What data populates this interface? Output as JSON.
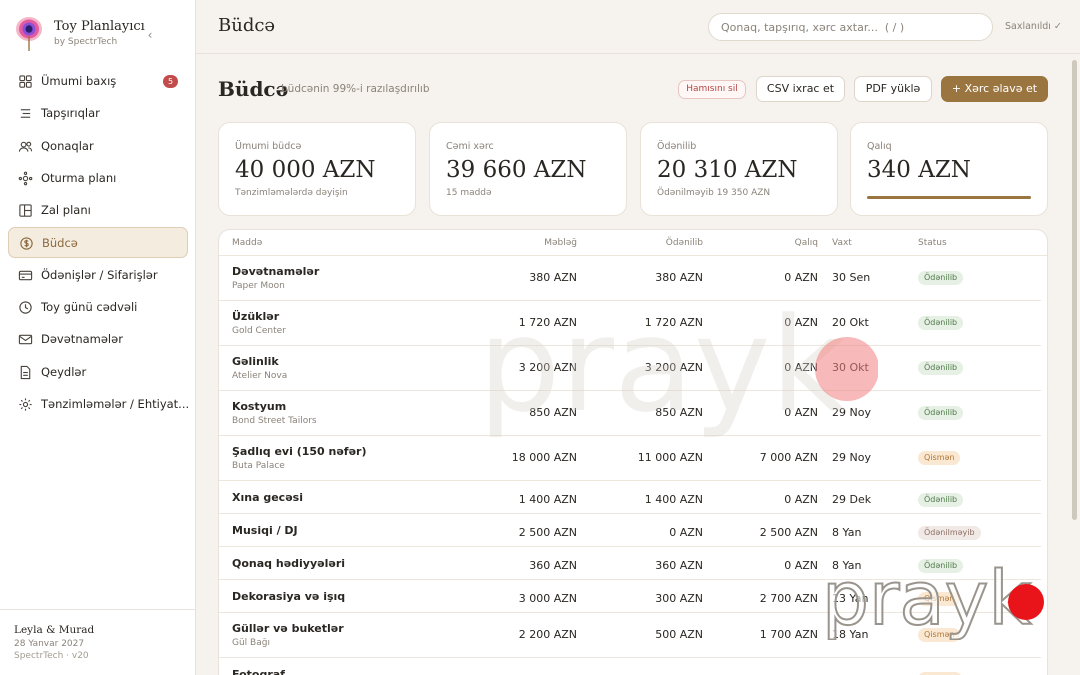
{
  "app": {
    "title": "Toy Planlayıcı",
    "subtitle": "by SpectrTech"
  },
  "sidebar": {
    "items": [
      {
        "label": "Ümumi baxış",
        "icon": "grid-icon",
        "badge": "5"
      },
      {
        "label": "Tapşırıqlar",
        "icon": "list-icon"
      },
      {
        "label": "Qonaqlar",
        "icon": "users-icon"
      },
      {
        "label": "Oturma planı",
        "icon": "seating-icon"
      },
      {
        "label": "Zal planı",
        "icon": "layout-icon"
      },
      {
        "label": "Büdcə",
        "icon": "coin-icon",
        "active": true
      },
      {
        "label": "Ödənişlər / Sifarişlər",
        "icon": "card-icon"
      },
      {
        "label": "Toy günü cədvəli",
        "icon": "clock-icon"
      },
      {
        "label": "Dəvətnamələr",
        "icon": "mail-icon"
      },
      {
        "label": "Qeydlər",
        "icon": "document-icon"
      },
      {
        "label": "Tənzimləmələr / Ehtiyat...",
        "icon": "gear-icon"
      }
    ],
    "footer": {
      "couple": "Leyla & Murad",
      "date": "28 Yanvar 2027",
      "version": "SpectrTech · v20"
    }
  },
  "topbar": {
    "title": "Büdcə",
    "search_placeholder": "Qonaq, tapşırıq, xərc axtar...  ( / )",
    "saved": "Saxlanıldı ✓"
  },
  "header": {
    "title": "Büdcə",
    "subtitle": "büdcənin 99%-i razılaşdırılıb",
    "clear_all": "Hamısını sil",
    "export_csv": "CSV ixrac et",
    "download_pdf": "PDF yüklə",
    "add_expense": "+ Xərc əlavə et"
  },
  "stats": [
    {
      "label": "Ümumi büdcə",
      "value": "40 000 AZN",
      "note": "Tənzimləmələrdə dəyişin"
    },
    {
      "label": "Cəmi xərc",
      "value": "39 660 AZN",
      "note": "15 maddə"
    },
    {
      "label": "Ödənilib",
      "value": "20 310 AZN",
      "note": "Ödənilməyib 19 350 AZN"
    },
    {
      "label": "Qalıq",
      "value": "340 AZN",
      "progress": 1.0
    }
  ],
  "table": {
    "columns": {
      "item": "Maddə",
      "amount": "Məbləğ",
      "paid": "Ödənilib",
      "remaining": "Qalıq",
      "due": "Vaxt",
      "status": "Status"
    },
    "rows": [
      {
        "name": "Dəvətnamələr",
        "vendor": "Paper Moon",
        "amount": "380 AZN",
        "paid": "380 AZN",
        "remaining": "0 AZN",
        "due": "30 Sen",
        "status": "Ödənilib",
        "status_type": "paid"
      },
      {
        "name": "Üzüklər",
        "vendor": "Gold Center",
        "amount": "1 720 AZN",
        "paid": "1 720 AZN",
        "remaining": "0 AZN",
        "due": "20 Okt",
        "status": "Ödənilib",
        "status_type": "paid"
      },
      {
        "name": "Gəlinlik",
        "vendor": "Atelier Nova",
        "amount": "3 200 AZN",
        "paid": "3 200 AZN",
        "remaining": "0 AZN",
        "due": "30 Okt",
        "status": "Ödənilib",
        "status_type": "paid"
      },
      {
        "name": "Kostyum",
        "vendor": "Bond Street Tailors",
        "amount": "850 AZN",
        "paid": "850 AZN",
        "remaining": "0 AZN",
        "due": "29 Noy",
        "status": "Ödənilib",
        "status_type": "paid"
      },
      {
        "name": "Şadlıq evi (150 nəfər)",
        "vendor": "Buta Palace",
        "amount": "18 000 AZN",
        "paid": "11 000 AZN",
        "remaining": "7 000 AZN",
        "due": "29 Noy",
        "status": "Qismən",
        "status_type": "partial"
      },
      {
        "name": "Xına gecəsi",
        "vendor": "",
        "amount": "1 400 AZN",
        "paid": "1 400 AZN",
        "remaining": "0 AZN",
        "due": "29 Dek",
        "status": "Ödənilib",
        "status_type": "paid"
      },
      {
        "name": "Musiqi / DJ",
        "vendor": "",
        "amount": "2 500 AZN",
        "paid": "0 AZN",
        "remaining": "2 500 AZN",
        "due": "8 Yan",
        "status": "Ödənilməyib",
        "status_type": "unpaid"
      },
      {
        "name": "Qonaq hədiyyələri",
        "vendor": "",
        "amount": "360 AZN",
        "paid": "360 AZN",
        "remaining": "0 AZN",
        "due": "8 Yan",
        "status": "Ödənilib",
        "status_type": "paid"
      },
      {
        "name": "Dekorasiya və işıq",
        "vendor": "",
        "amount": "3 000 AZN",
        "paid": "300 AZN",
        "remaining": "2 700 AZN",
        "due": "13 Yan",
        "status": "Qismən",
        "status_type": "partial"
      },
      {
        "name": "Güllər və buketlər",
        "vendor": "Gül Bağı",
        "amount": "2 200 AZN",
        "paid": "500 AZN",
        "remaining": "1 700 AZN",
        "due": "18 Yan",
        "status": "Qismən",
        "status_type": "partial"
      },
      {
        "name": "Fotoqraf",
        "vendor": "",
        "amount": "",
        "paid": "",
        "remaining": "",
        "due": "",
        "status": "",
        "status_type": "partial"
      }
    ]
  },
  "watermark": {
    "text": "prayk"
  },
  "colors": {
    "accent": "#9a7540",
    "badge": "#c24b4b",
    "paid_bg": "#e6f0e4",
    "partial_bg": "#fae8d2",
    "unpaid_bg": "#f1e9e5",
    "watermark_dot": "#e8141a"
  }
}
